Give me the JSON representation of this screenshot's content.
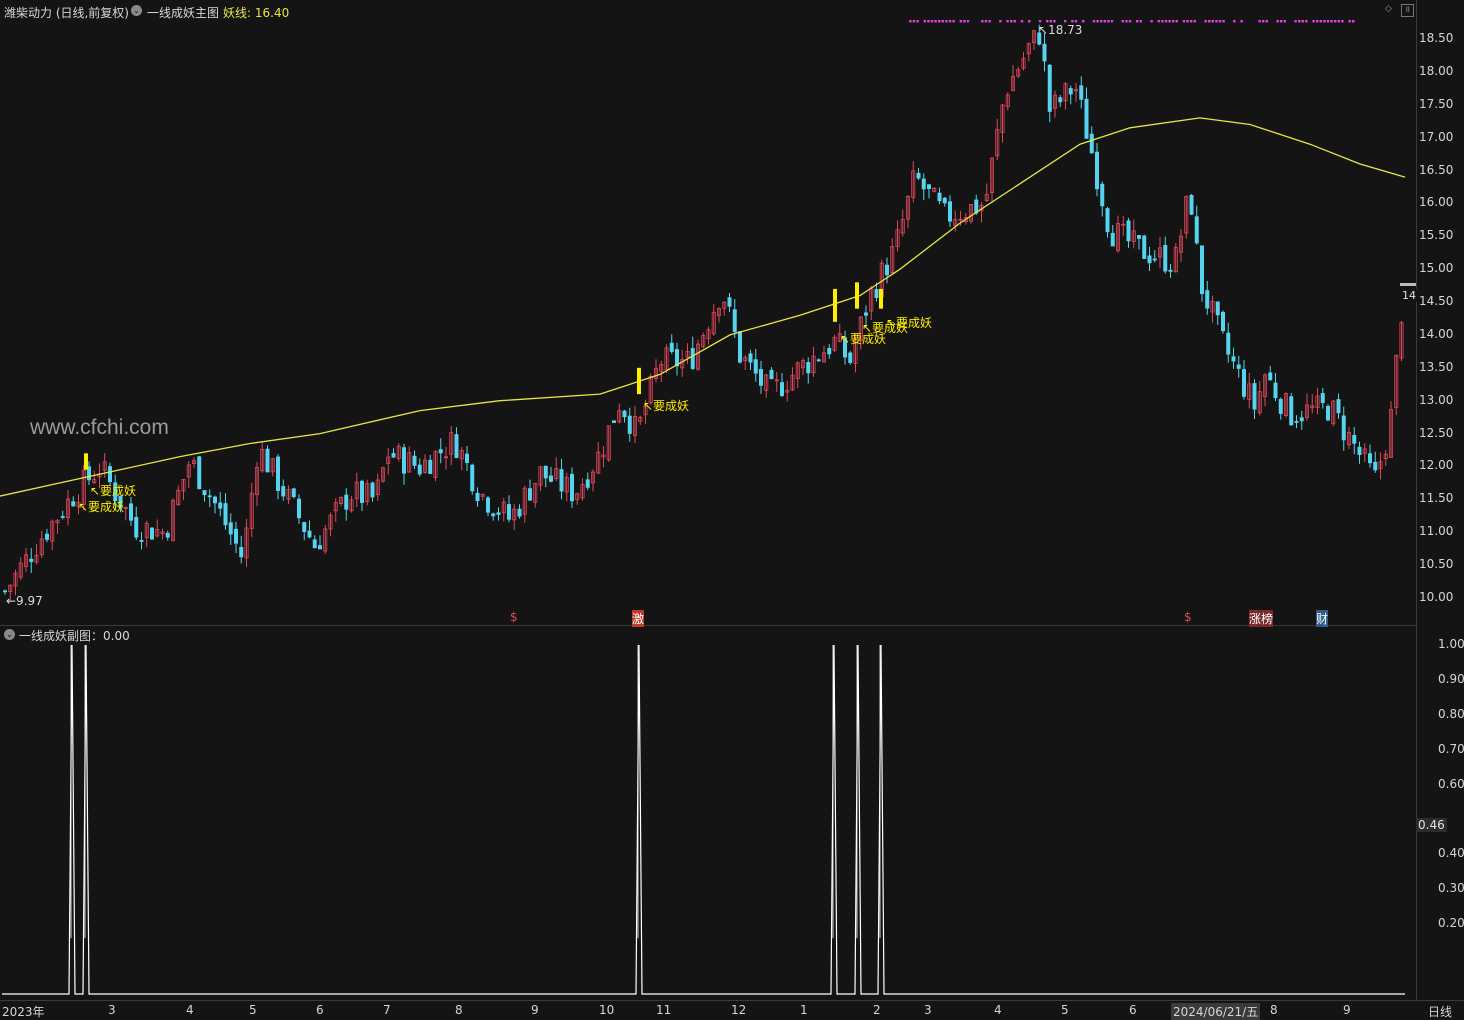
{
  "main_header": {
    "stock_title": "潍柴动力 (日线,前复权)",
    "indicator_name": "一线成妖主图",
    "line_label": "妖线: 16.40"
  },
  "sub_header": {
    "indicator_label": "一线成妖副图：0.00"
  },
  "watermark": "www.cfchi.com",
  "price_axis": [
    "18.50",
    "18.00",
    "17.50",
    "17.00",
    "16.50",
    "16.00",
    "15.50",
    "15.00",
    "14.50",
    "14.00",
    "13.50",
    "13.00",
    "12.50",
    "12.00",
    "11.50",
    "11.00",
    "10.50",
    "10.00"
  ],
  "sub_axis": [
    "1.00",
    "0.90",
    "0.80",
    "0.70",
    "0.60",
    "0.40",
    "0.30",
    "0.20"
  ],
  "sub_cursor_value": "0.46",
  "price_cursor_value": "14",
  "time_axis": [
    "2023年",
    "3",
    "4",
    "5",
    "6",
    "7",
    "8",
    "9",
    "10",
    "11",
    "12",
    "1",
    "2",
    "3",
    "4",
    "5",
    "6",
    "2024/06/21/五",
    "8",
    "9"
  ],
  "period_label": "日线",
  "annotations": {
    "high_label": "18.73",
    "low_label": "9.97",
    "signal_text": "要成妖"
  },
  "event_markers": [
    "$",
    "激",
    "$",
    "涨榜",
    "财"
  ],
  "colors": {
    "background": "#141414",
    "up_candle": "#e0475a",
    "down_candle": "#54d4ee",
    "yao_line": "#e6e645",
    "signal_bar": "#ffee00",
    "top_dots": "#e040e0",
    "sub_line": "#ffffff"
  },
  "chart_data": [
    {
      "type": "candlestick",
      "title": "一线成妖主图",
      "series": [
        {
          "name": "妖线",
          "last_value": 16.4
        }
      ],
      "ylim": [
        9.8,
        18.8
      ],
      "y_ticks": [
        10.0,
        10.5,
        11.0,
        11.5,
        12.0,
        12.5,
        13.0,
        13.5,
        14.0,
        14.5,
        15.0,
        15.5,
        16.0,
        16.5,
        17.0,
        17.5,
        18.0,
        18.5
      ],
      "x_range": [
        "2023-02",
        "2024-10"
      ],
      "max_price": 18.73,
      "min_price": 9.97,
      "approx_close_path": [
        {
          "x": "2023-02",
          "close": 10.1
        },
        {
          "x": "2023-02-late",
          "close": 11.6
        },
        {
          "x": "2023-03",
          "close": 11.1
        },
        {
          "x": "2023-04",
          "close": 12.1
        },
        {
          "x": "2023-04-late",
          "close": 10.8
        },
        {
          "x": "2023-05",
          "close": 12.3
        },
        {
          "x": "2023-06",
          "close": 11.0
        },
        {
          "x": "2023-07",
          "close": 12.2
        },
        {
          "x": "2023-08",
          "close": 12.3
        },
        {
          "x": "2023-09",
          "close": 11.3
        },
        {
          "x": "2023-10",
          "close": 12.1
        },
        {
          "x": "2023-10-late",
          "close": 12.9
        },
        {
          "x": "2023-11",
          "close": 13.6
        },
        {
          "x": "2023-11-late",
          "close": 14.8
        },
        {
          "x": "2023-12",
          "close": 13.6
        },
        {
          "x": "2024-01",
          "close": 13.4
        },
        {
          "x": "2024-02",
          "close": 14.6
        },
        {
          "x": "2024-03",
          "close": 16.4
        },
        {
          "x": "2024-04",
          "close": 16.2
        },
        {
          "x": "2024-04-late",
          "close": 18.5
        },
        {
          "x": "2024-05",
          "close": 17.4
        },
        {
          "x": "2024-06",
          "close": 15.6
        },
        {
          "x": "2024-06-late",
          "close": 15.8
        },
        {
          "x": "2024-07",
          "close": 13.7
        },
        {
          "x": "2024-08",
          "close": 12.8
        },
        {
          "x": "2024-09",
          "close": 11.8
        },
        {
          "x": "2024-10",
          "close": 14.9
        }
      ]
    },
    {
      "type": "line",
      "title": "一线成妖副图",
      "series": [
        {
          "name": "一线成妖副图",
          "last_value": 0.0
        }
      ],
      "ylim": [
        0,
        1.05
      ],
      "spike_value": 1.0,
      "baseline_value": 0.0,
      "spike_count": 6
    }
  ]
}
